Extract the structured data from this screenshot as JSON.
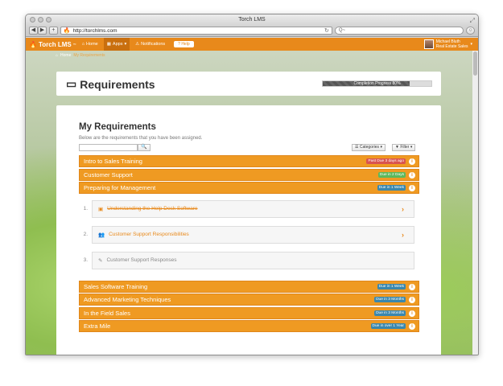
{
  "window": {
    "title": "Torch LMS",
    "url": "http://torchlms.com",
    "search_placeholder": "Q~"
  },
  "appnav": {
    "brand": "Torch LMS",
    "brand_tm": "™",
    "items": [
      {
        "label": "Home",
        "icon": "home-icon"
      },
      {
        "label": "Apps",
        "icon": "grid-icon"
      },
      {
        "label": "Notifications",
        "icon": "warning-icon"
      }
    ],
    "help_label": "Help",
    "user_name": "Michael Bluth",
    "user_role": "Real Estate Sales"
  },
  "breadcrumb": {
    "home": "Home",
    "current": "My Requirements"
  },
  "header": {
    "title": "Requirements",
    "progress_label": "Completion Progress 80%",
    "progress": 0.8
  },
  "main": {
    "title": "My Requirements",
    "subtitle": "Below are the requirements that you have been assigned.",
    "categories_label": "Categories",
    "filter_label": "Filter",
    "groups_top": [
      {
        "label": "Intro to Sales Training",
        "badge": "Past Due 3 days ago",
        "badge_color": "#d9534f"
      },
      {
        "label": "Customer Support",
        "badge": "Due in 2 Days",
        "badge_color": "#5cb85c"
      },
      {
        "label": "Preparing for Management",
        "badge": "Due in 1 Week",
        "badge_color": "#3a87ad"
      }
    ],
    "subitems": [
      {
        "num": "1.",
        "label": "Understanding the Help Desk Software",
        "icon": "video-icon",
        "state": "done"
      },
      {
        "num": "2.",
        "label": "Customer Support Responsibilities",
        "icon": "users-icon",
        "state": "active"
      },
      {
        "num": "3.",
        "label": "Customer Support Responses",
        "icon": "pencil-icon",
        "state": "pending"
      }
    ],
    "groups_bottom": [
      {
        "label": "Sales Software Training",
        "badge": "Due in 1 Week",
        "badge_color": "#3a87ad"
      },
      {
        "label": "Advanced Marketing Techniques",
        "badge": "Due in 3 Months",
        "badge_color": "#3a87ad"
      },
      {
        "label": "In the Field Sales",
        "badge": "Due in 3 Months",
        "badge_color": "#3a87ad"
      },
      {
        "label": "Extra Mile",
        "badge": "Due in over 1 Year",
        "badge_color": "#3a87ad"
      }
    ]
  }
}
